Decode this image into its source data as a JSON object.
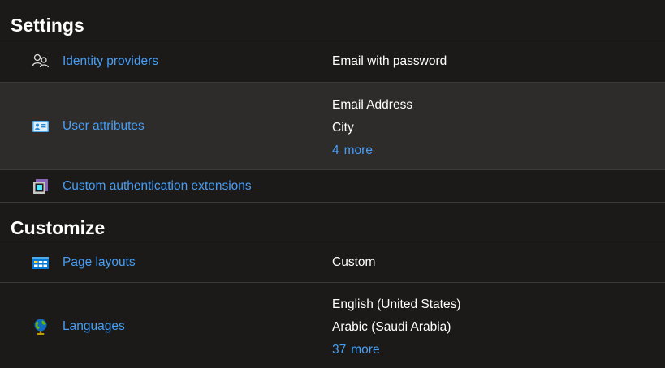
{
  "settings": {
    "title": "Settings",
    "rows": [
      {
        "label": "Identity providers",
        "values": [
          "Email with password"
        ]
      },
      {
        "label": "User attributes",
        "values": [
          "Email Address",
          "City"
        ],
        "more_count": "4",
        "more_label": "more"
      },
      {
        "label": "Custom authentication extensions",
        "values": []
      }
    ]
  },
  "customize": {
    "title": "Customize",
    "rows": [
      {
        "label": "Page layouts",
        "values": [
          "Custom"
        ]
      },
      {
        "label": "Languages",
        "values": [
          "English (United States)",
          "Arabic (Saudi Arabia)"
        ],
        "more_count": "37",
        "more_label": "more"
      }
    ]
  },
  "colors": {
    "background": "#1b1a19",
    "selected_row": "#2d2c2b",
    "link": "#479ef5",
    "divider": "#3b3a39"
  },
  "icons": {
    "identity_providers": "people-icon",
    "user_attributes": "contact-card-icon",
    "custom_auth_extensions": "extension-icon",
    "page_layouts": "page-layout-icon",
    "languages": "globe-icon"
  }
}
